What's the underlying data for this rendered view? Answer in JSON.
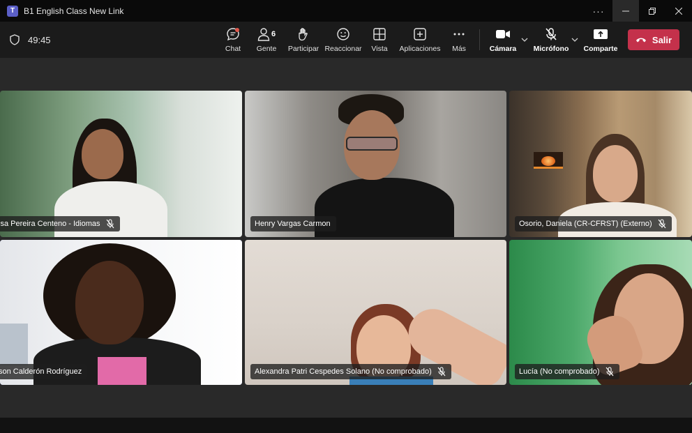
{
  "window": {
    "title": "B1 English Class New Link"
  },
  "toolbar": {
    "timer": "49:45",
    "chat": "Chat",
    "people": "Gente",
    "people_count": "6",
    "raise": "Participar",
    "react": "Reaccionar",
    "view": "Vista",
    "apps": "Aplicaciones",
    "more": "Más",
    "camera": "Cámara",
    "mic": "Micrófono",
    "share": "Comparte",
    "leave": "Salir"
  },
  "participants": [
    {
      "name": "isa Pereira Centeno - Idiomas",
      "muted": true
    },
    {
      "name": "Henry Vargas Carmon",
      "muted": false
    },
    {
      "name": "Osorio, Daniela (CR-CFRST) (Externo)",
      "muted": true
    },
    {
      "name": "son Calderón Rodríguez",
      "muted": false,
      "active": true
    },
    {
      "name": "Alexandra Patri Cespedes Solano (No comprobado)",
      "muted": true
    },
    {
      "name": "Lucía (No comprobado)",
      "muted": true
    }
  ],
  "colors": {
    "accent": "#7f85f5",
    "leave": "#c4314b",
    "background": "#292929"
  }
}
